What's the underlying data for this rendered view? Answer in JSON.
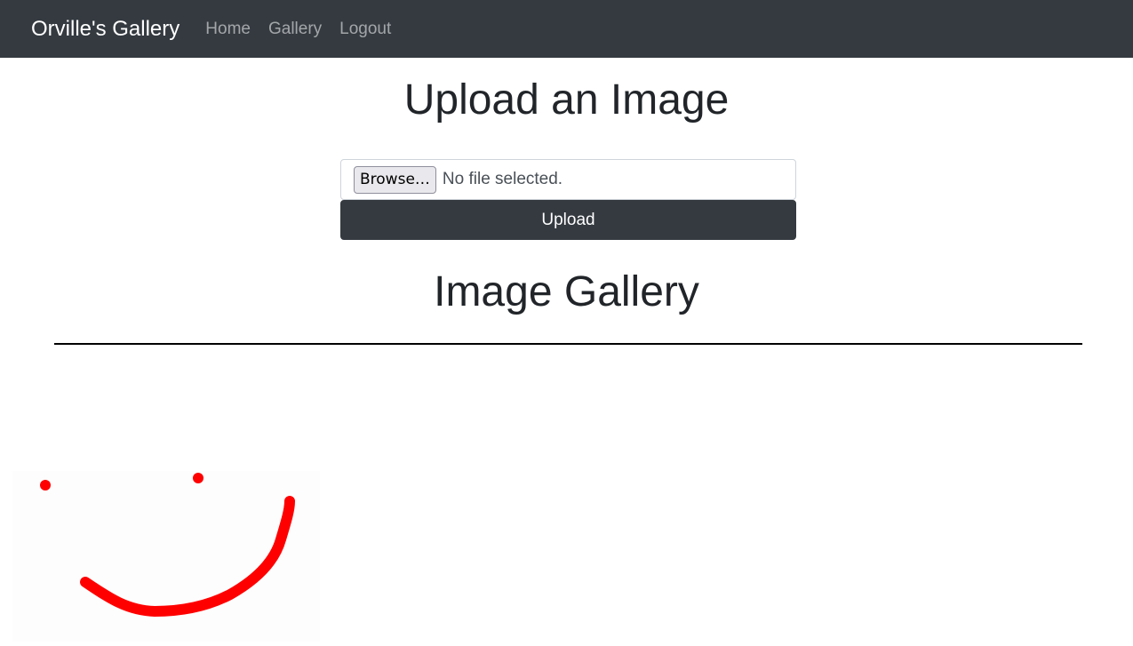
{
  "navbar": {
    "brand": "Orville's Gallery",
    "links": [
      "Home",
      "Gallery",
      "Logout"
    ]
  },
  "upload": {
    "title": "Upload an Image",
    "browse_label": "Browse…",
    "file_status": "No file selected.",
    "submit_label": "Upload"
  },
  "gallery": {
    "title": "Image Gallery",
    "images": [
      {
        "description": "red smiley face drawing"
      }
    ]
  },
  "colors": {
    "navbar_bg": "#343a40",
    "accent_red": "#ff0000"
  }
}
